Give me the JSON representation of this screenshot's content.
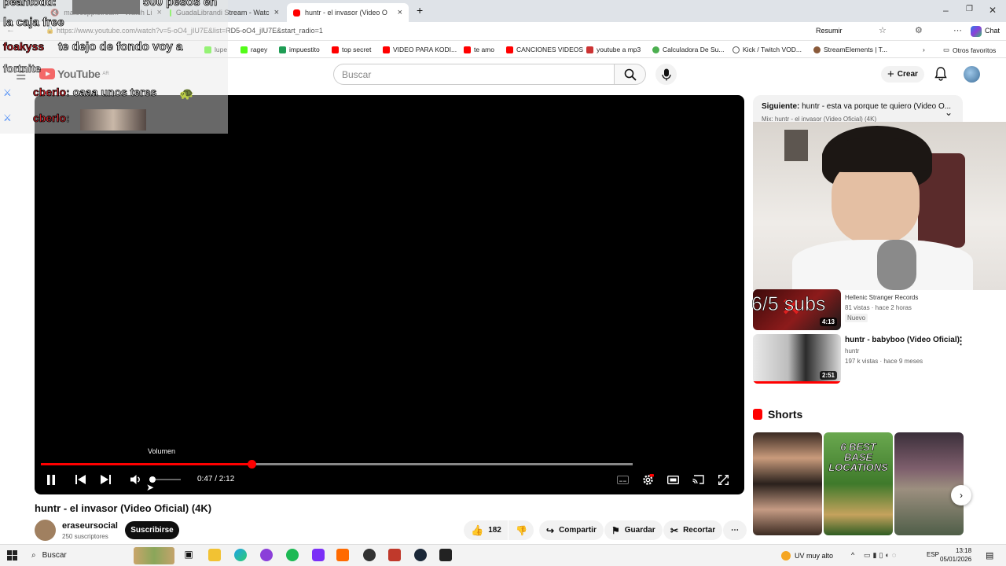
{
  "browser": {
    "tabs": [
      {
        "label": "matecupp.stream - Watch Li"
      },
      {
        "label": "GuadaLibrandi Stream - Watc"
      },
      {
        "label": "huntr - el invasor (Video Ofici"
      }
    ],
    "new_tab": "+",
    "url": "https://www.youtube.com/watch?v=5-oO4_jIU7E&list=RD5-oO4_jIU7E&start_radio=1",
    "resume_label": "Resumir",
    "chat_label": "Chat",
    "bookmarks": [
      "lupe",
      "ragey",
      "impuestito",
      "top secret",
      "VIDEO PARA KODI...",
      "te amo",
      "CANCIONES VIDEOS",
      "youtube a mp3",
      "Calculadora De Su...",
      "Kick / Twitch VOD...",
      "StreamElements | T..."
    ],
    "other_bookmarks": "Otros favoritos",
    "colors": {
      "yt_red": "#ff0000",
      "kick_green": "#53fc18"
    }
  },
  "stream_overlay": {
    "lines": [
      "peantodd:",
      "500 pesos en",
      "la caja free",
      "te dejo de fondo voy a",
      "fortnite"
    ],
    "chat": [
      {
        "user": "cberlo",
        "msg": "oaaa unos teres"
      },
      {
        "user": "cberlo",
        "msg": ""
      }
    ],
    "sub_counter": "6/5 subs"
  },
  "header": {
    "logo_text": "YouTube",
    "region": "AR",
    "search_placeholder": "Buscar",
    "create_label": "Crear"
  },
  "player": {
    "time": "0:47 / 2:12",
    "volume_tooltip": "Volumen",
    "progress_fraction": 0.356,
    "volume_fraction": 0.1
  },
  "video": {
    "title": "huntr - el invasor (Video Oficial) (4K)",
    "channel": "eraseursocial",
    "subscribers": "250 suscriptores",
    "subscribe_label": "Suscribirse",
    "likes": "182",
    "share_label": "Compartir",
    "save_label": "Guardar",
    "clip_label": "Recortar"
  },
  "sidebar": {
    "up_next_prefix": "Siguiente:",
    "up_next_title": "huntr - esta va porque te quiero (Video O...",
    "up_next_mix": "Mix: huntr - el invasor (Video Oficial) (4K)",
    "videos": [
      {
        "title": "",
        "channel": "Hellenic Stranger Records",
        "meta": "81 vistas · hace 2 horas",
        "badge": "Nuevo",
        "duration": "4:13"
      },
      {
        "title": "huntr - babyboo (Video Oficial)",
        "channel": "huntr",
        "meta": "197 k vistas · hace 9 meses",
        "duration": "2:51"
      }
    ],
    "shorts_heading": "Shorts",
    "shorts": [
      {
        "label": ""
      },
      {
        "label": "6 BEST BASE LOCATIONS"
      },
      {
        "label": ""
      }
    ]
  },
  "taskbar": {
    "search_placeholder": "Buscar",
    "weather": "UV muy alto",
    "lang": "ESP",
    "time": "13:18",
    "date": "05/01/2026"
  }
}
